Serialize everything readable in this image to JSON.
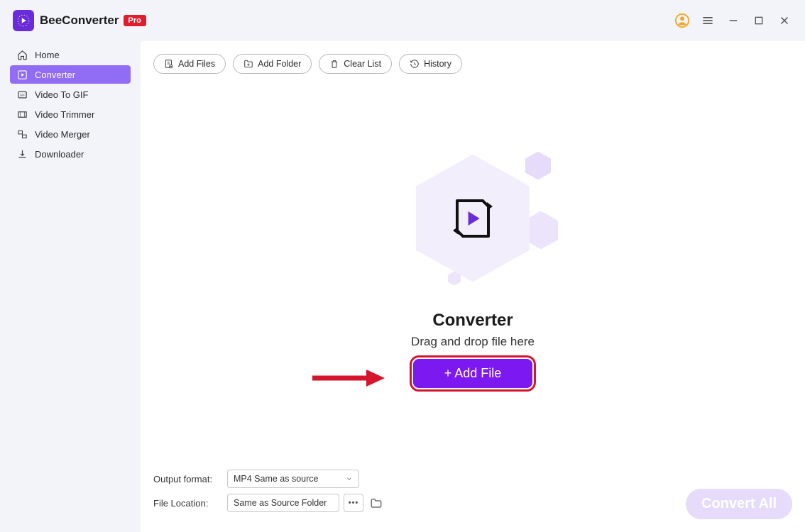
{
  "header": {
    "app_title": "BeeConverter",
    "pro_badge": "Pro"
  },
  "sidebar": {
    "items": [
      {
        "label": "Home"
      },
      {
        "label": "Converter"
      },
      {
        "label": "Video To GIF"
      },
      {
        "label": "Video Trimmer"
      },
      {
        "label": "Video Merger"
      },
      {
        "label": "Downloader"
      }
    ]
  },
  "toolbar": {
    "add_files": "Add Files",
    "add_folder": "Add Folder",
    "clear_list": "Clear List",
    "history": "History"
  },
  "center": {
    "title": "Converter",
    "subtitle": "Drag and drop file here",
    "add_file_button": "+ Add File"
  },
  "bottom": {
    "output_format_label": "Output format:",
    "output_format_value": "MP4 Same as source",
    "file_location_label": "File Location:",
    "file_location_value": "Same as Source Folder",
    "convert_all": "Convert All"
  }
}
